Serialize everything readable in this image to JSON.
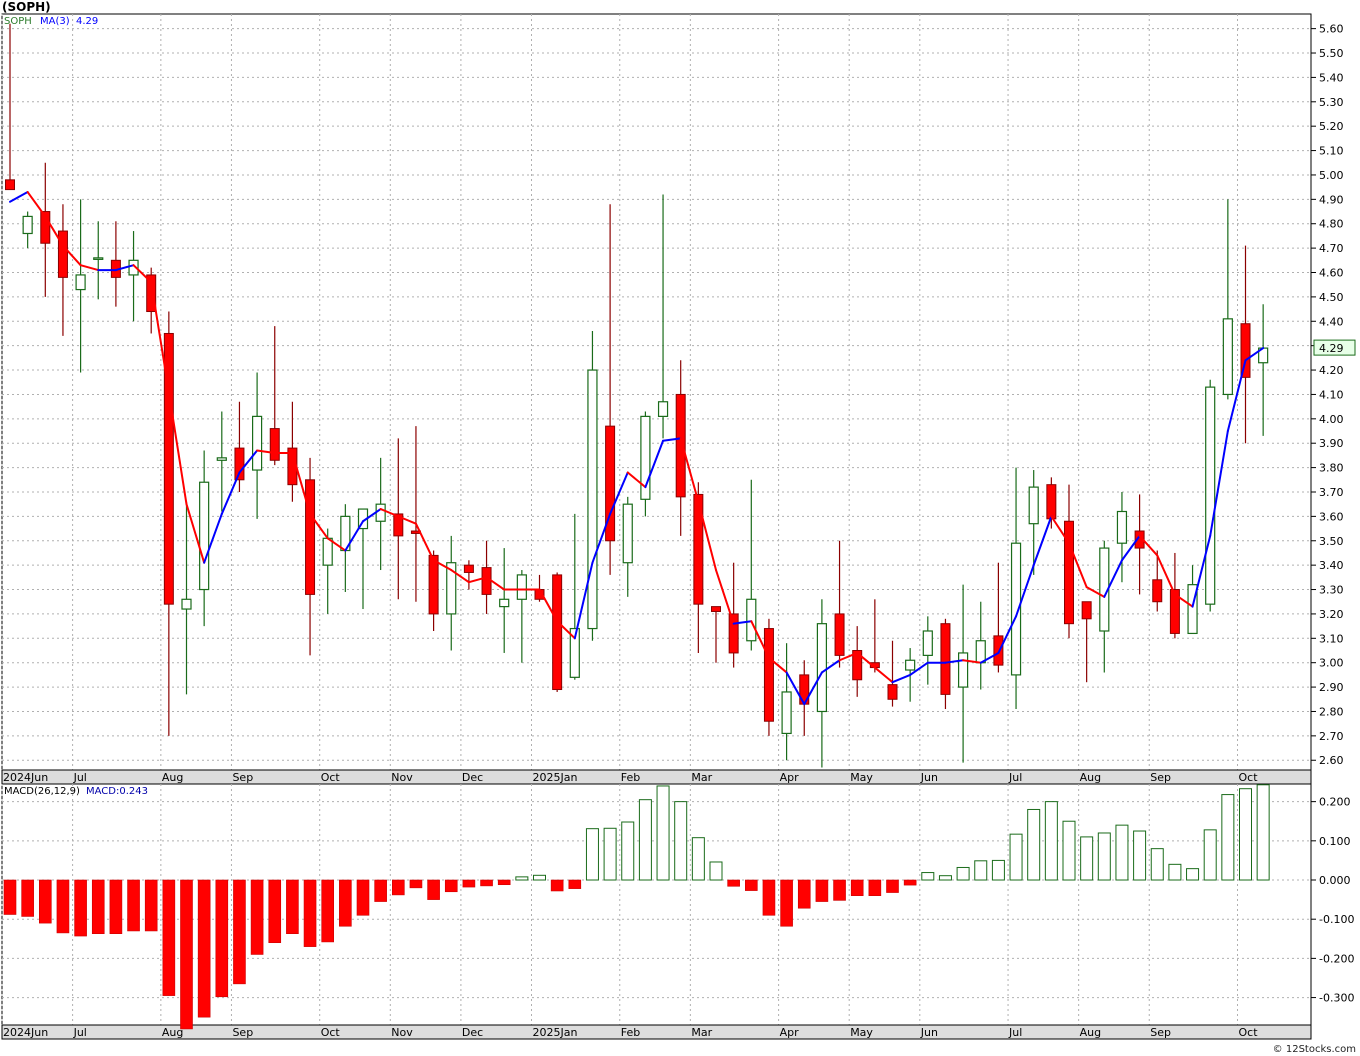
{
  "title": "(SOPH)",
  "legend": {
    "symbol": "SOPH",
    "ma_label": "MA(3)",
    "ma_value": "4.29",
    "macd_label": "MACD(26,12,9)",
    "macd_value_label": "MACD:0.243"
  },
  "credit": "© 12Stocks.com",
  "colors": {
    "up": "#1a6b1a",
    "down": "#ff0000",
    "down_wick": "#8b0000",
    "ma_up": "#0000ff",
    "ma_down": "#ff0000",
    "grid": "#b0b0b0",
    "axis_band": "#dddddd",
    "price_tag_bg": "#e8ffe8",
    "price_tag_border": "#1a6b1a"
  },
  "chart_data": [
    {
      "type": "candlestick",
      "series_name": "SOPH",
      "overlay": "MA(3)",
      "last_price": "4.29",
      "y_ticks": [
        "2.60",
        "2.70",
        "2.80",
        "2.90",
        "3.00",
        "3.10",
        "3.20",
        "3.30",
        "3.40",
        "3.50",
        "3.60",
        "3.70",
        "3.80",
        "3.90",
        "4.00",
        "4.10",
        "4.20",
        "4.30",
        "4.40",
        "4.50",
        "4.60",
        "4.70",
        "4.80",
        "4.90",
        "5.00",
        "5.10",
        "5.20",
        "5.30",
        "5.40",
        "5.50",
        "5.60"
      ],
      "ylim": [
        2.56,
        5.66
      ],
      "x_labels": [
        "2024Jun",
        "Jul",
        "Aug",
        "Sep",
        "Oct",
        "Nov",
        "Dec",
        "2025Jan",
        "Feb",
        "Mar",
        "Apr",
        "May",
        "Jun",
        "Jul",
        "Aug",
        "Sep",
        "Oct"
      ],
      "x_label_weeks": [
        0,
        4,
        9,
        13,
        18,
        22,
        26,
        30,
        35,
        39,
        44,
        48,
        52,
        57,
        61,
        65,
        70
      ],
      "candles": [
        [
          4.98,
          5.62,
          4.95,
          4.94
        ],
        [
          4.76,
          4.85,
          4.7,
          4.83
        ],
        [
          4.85,
          5.05,
          4.5,
          4.72
        ],
        [
          4.77,
          4.88,
          4.34,
          4.58
        ],
        [
          4.53,
          4.9,
          4.19,
          4.59
        ],
        [
          4.66,
          4.81,
          4.49,
          4.66
        ],
        [
          4.65,
          4.81,
          4.46,
          4.58
        ],
        [
          4.59,
          4.77,
          4.4,
          4.65
        ],
        [
          4.59,
          4.62,
          4.35,
          4.44
        ],
        [
          4.35,
          4.44,
          2.7,
          3.24
        ],
        [
          3.22,
          3.66,
          2.87,
          3.26
        ],
        [
          3.3,
          3.87,
          3.15,
          3.74
        ],
        [
          3.83,
          4.03,
          3.62,
          3.84
        ],
        [
          3.88,
          4.07,
          3.7,
          3.75
        ],
        [
          3.79,
          4.19,
          3.59,
          4.01
        ],
        [
          3.96,
          4.38,
          3.81,
          3.83
        ],
        [
          3.88,
          4.07,
          3.66,
          3.73
        ],
        [
          3.75,
          3.84,
          3.03,
          3.28
        ],
        [
          3.4,
          3.55,
          3.2,
          3.51
        ],
        [
          3.46,
          3.65,
          3.29,
          3.6
        ],
        [
          3.55,
          3.63,
          3.22,
          3.63
        ],
        [
          3.58,
          3.84,
          3.38,
          3.65
        ],
        [
          3.61,
          3.92,
          3.26,
          3.52
        ],
        [
          3.54,
          3.97,
          3.25,
          3.53
        ],
        [
          3.44,
          3.46,
          3.13,
          3.2
        ],
        [
          3.2,
          3.52,
          3.05,
          3.41
        ],
        [
          3.4,
          3.42,
          3.3,
          3.37
        ],
        [
          3.39,
          3.5,
          3.2,
          3.28
        ],
        [
          3.23,
          3.47,
          3.04,
          3.26
        ],
        [
          3.26,
          3.38,
          3.0,
          3.36
        ],
        [
          3.3,
          3.36,
          3.25,
          3.26
        ],
        [
          3.36,
          3.37,
          2.88,
          2.89
        ],
        [
          2.94,
          3.61,
          2.93,
          3.14
        ],
        [
          3.14,
          4.36,
          3.09,
          4.2
        ],
        [
          3.97,
          4.88,
          3.36,
          3.5
        ],
        [
          3.41,
          3.68,
          3.27,
          3.65
        ],
        [
          3.67,
          4.03,
          3.6,
          4.01
        ],
        [
          4.01,
          4.92,
          3.92,
          4.07
        ],
        [
          4.1,
          4.24,
          3.52,
          3.68
        ],
        [
          3.69,
          3.74,
          3.04,
          3.24
        ],
        [
          3.23,
          3.22,
          3.0,
          3.21
        ],
        [
          3.2,
          3.41,
          2.98,
          3.04
        ],
        [
          3.09,
          3.75,
          3.05,
          3.26
        ],
        [
          3.14,
          3.18,
          2.7,
          2.76
        ],
        [
          2.71,
          3.08,
          2.6,
          2.88
        ],
        [
          2.95,
          3.01,
          2.7,
          2.83
        ],
        [
          2.8,
          3.26,
          2.57,
          3.16
        ],
        [
          3.2,
          3.5,
          2.98,
          3.03
        ],
        [
          3.05,
          3.15,
          2.86,
          2.93
        ],
        [
          3.0,
          3.26,
          2.96,
          2.98
        ],
        [
          2.91,
          3.09,
          2.82,
          2.85
        ],
        [
          2.97,
          3.06,
          2.84,
          3.01
        ],
        [
          3.03,
          3.19,
          2.91,
          3.13
        ],
        [
          3.16,
          3.18,
          2.81,
          2.87
        ],
        [
          2.9,
          3.32,
          2.59,
          3.04
        ],
        [
          3.0,
          3.25,
          2.89,
          3.09
        ],
        [
          3.11,
          3.41,
          2.96,
          2.99
        ],
        [
          2.95,
          3.8,
          2.81,
          3.49
        ],
        [
          3.57,
          3.79,
          3.36,
          3.72
        ],
        [
          3.73,
          3.76,
          3.55,
          3.59
        ],
        [
          3.58,
          3.73,
          3.1,
          3.16
        ],
        [
          3.25,
          3.25,
          2.92,
          3.18
        ],
        [
          3.13,
          3.5,
          2.96,
          3.47
        ],
        [
          3.49,
          3.7,
          3.33,
          3.62
        ],
        [
          3.54,
          3.69,
          3.28,
          3.47
        ],
        [
          3.34,
          3.46,
          3.21,
          3.25
        ],
        [
          3.3,
          3.45,
          3.1,
          3.12
        ],
        [
          3.12,
          3.4,
          3.12,
          3.32
        ],
        [
          3.24,
          4.16,
          3.21,
          4.13
        ],
        [
          4.1,
          4.9,
          4.08,
          4.41
        ],
        [
          4.39,
          4.71,
          3.9,
          4.17
        ],
        [
          4.23,
          4.47,
          3.93,
          4.29
        ]
      ],
      "ma3": [
        4.89,
        4.93,
        4.83,
        4.71,
        4.63,
        4.61,
        4.61,
        4.63,
        4.56,
        4.11,
        3.65,
        3.41,
        3.61,
        3.78,
        3.87,
        3.86,
        3.86,
        3.61,
        3.51,
        3.46,
        3.58,
        3.63,
        3.6,
        3.57,
        3.42,
        3.38,
        3.33,
        3.35,
        3.3,
        3.3,
        3.3,
        3.17,
        3.1,
        3.41,
        3.61,
        3.78,
        3.72,
        3.91,
        3.92,
        3.66,
        3.38,
        3.16,
        3.17,
        3.02,
        2.96,
        2.83,
        2.96,
        3.01,
        3.04,
        2.98,
        2.92,
        2.95,
        3.0,
        3.0,
        3.01,
        3.0,
        3.04,
        3.19,
        3.4,
        3.6,
        3.49,
        3.31,
        3.27,
        3.42,
        3.52,
        3.44,
        3.28,
        3.23,
        3.52,
        3.95,
        4.24,
        4.29
      ],
      "ma3_direction": [
        "up",
        "up",
        "down",
        "down",
        "down",
        "down",
        "up",
        "up",
        "down",
        "down",
        "down",
        "down",
        "up",
        "up",
        "up",
        "down",
        "down",
        "down",
        "down",
        "down",
        "up",
        "up",
        "down",
        "down",
        "down",
        "down",
        "down",
        "down",
        "down",
        "down",
        "down",
        "down",
        "down",
        "up",
        "up",
        "up",
        "down",
        "up",
        "up",
        "down",
        "down",
        "down",
        "up",
        "down",
        "down",
        "up",
        "up",
        "up",
        "down",
        "down",
        "down",
        "up",
        "up",
        "up",
        "up",
        "down",
        "up",
        "up",
        "up",
        "up",
        "down",
        "down",
        "down",
        "up",
        "up",
        "down",
        "down",
        "down",
        "up",
        "up",
        "up",
        "up"
      ]
    },
    {
      "type": "bar",
      "series_name": "MACD(26,12,9)",
      "last_value": "0.243",
      "y_ticks": [
        "0.200",
        "0.100",
        "0.000",
        "-0.100",
        "-0.200",
        "-0.300"
      ],
      "ylim": [
        -0.37,
        0.245
      ],
      "x_labels": [
        "2024Jun",
        "Jul",
        "Aug",
        "Sep",
        "Oct",
        "Nov",
        "Dec",
        "2025Jan",
        "Feb",
        "Mar",
        "Apr",
        "May",
        "Jun",
        "Jul",
        "Aug",
        "Sep",
        "Oct"
      ],
      "values": [
        -0.088,
        -0.093,
        -0.11,
        -0.135,
        -0.143,
        -0.137,
        -0.137,
        -0.13,
        -0.13,
        -0.295,
        -0.38,
        -0.35,
        -0.298,
        -0.265,
        -0.19,
        -0.16,
        -0.137,
        -0.17,
        -0.158,
        -0.118,
        -0.09,
        -0.055,
        -0.038,
        -0.02,
        -0.05,
        -0.03,
        -0.018,
        -0.015,
        -0.012,
        0.008,
        0.012,
        -0.028,
        -0.022,
        0.131,
        0.132,
        0.148,
        0.205,
        0.24,
        0.2,
        0.108,
        0.046,
        -0.016,
        -0.027,
        -0.09,
        -0.118,
        -0.072,
        -0.055,
        -0.052,
        -0.04,
        -0.04,
        -0.032,
        -0.013,
        0.019,
        0.011,
        0.032,
        0.049,
        0.05,
        0.117,
        0.18,
        0.2,
        0.15,
        0.11,
        0.12,
        0.14,
        0.125,
        0.08,
        0.04,
        0.029,
        0.128,
        0.218,
        0.233,
        0.243
      ]
    }
  ]
}
